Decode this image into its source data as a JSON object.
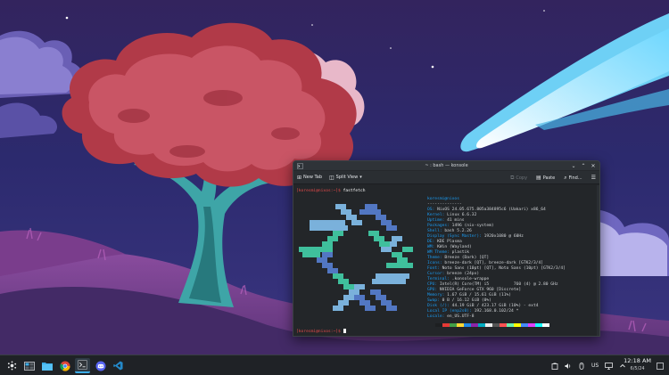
{
  "window": {
    "title": "~ : bash — konsole",
    "minimize_glyph": "⌄",
    "maximize_glyph": "⌃",
    "close_glyph": "✕"
  },
  "toolbar": {
    "new_tab": "New Tab",
    "split_view": "Split View",
    "split_chevron": "▾",
    "copy": "Copy",
    "paste": "Paste",
    "find": "Find...",
    "new_tab_icon": "⊞",
    "split_icon": "◫",
    "copy_icon": "⧉",
    "paste_icon": "▤",
    "find_icon": "⌕",
    "menu_icon": "☰"
  },
  "terminal": {
    "prompt1_user": "[koresmi@nixos:~]$",
    "command1": " fastfetch",
    "header": "koresmi@nixos",
    "separator": "--------------",
    "info": [
      {
        "key": "OS:",
        "value": " NixOS 24.05.675.805a384895c6 (Uakari) x86_64"
      },
      {
        "key": "Kernel:",
        "value": " Linux 6.6.32"
      },
      {
        "key": "Uptime:",
        "value": " 41 mins"
      },
      {
        "key": "Packages:",
        "value": " 1496 (nix-system)"
      },
      {
        "key": "Shell:",
        "value": " bash 5.2.26"
      },
      {
        "key": "Display (Sync Master):",
        "value": " 1920x1080 @ 60Hz"
      },
      {
        "key": "DE:",
        "value": " KDE Plasma"
      },
      {
        "key": "WM:",
        "value": " KWin (Wayland)"
      },
      {
        "key": "WM Theme:",
        "value": " plastik"
      },
      {
        "key": "Theme:",
        "value": " Breeze (Dark) [QT]"
      },
      {
        "key": "Icons:",
        "value": " breeze-dark [QT], breeze-dark [GTK2/3/4]"
      },
      {
        "key": "Font:",
        "value": " Noto Sans (10pt) [QT], Noto Sans (10pt) [GTK2/3/4]"
      },
      {
        "key": "Cursor:",
        "value": " breeze (24px)"
      },
      {
        "key": "Terminal:",
        "value": " .konsole-wrappe"
      },
      {
        "key": "CPU:",
        "value": " Intel(R) Core(TM) i5          760 (4) @ 2.80 GHz"
      },
      {
        "key": "GPU:",
        "value": " NVIDIA GeForce GTX 960 [Discrete]"
      },
      {
        "key": "Memory:",
        "value": " 1.67 GiB / 15.61 GiB (11%)"
      },
      {
        "key": "Swap:",
        "value": " 0 B / 16.12 GiB (0%)"
      },
      {
        "key": "Disk (/):",
        "value": " 44.19 GiB / 423.17 GiB (10%) - ext4"
      },
      {
        "key": "Local IP (enp2s0):",
        "value": " 192.168.0.102/24 *"
      },
      {
        "key": "Locale:",
        "value": " en_US.UTF-8"
      }
    ],
    "prompt2_user": "[koresmi@nixos:~]$",
    "palette": [
      "#1d1f21",
      "#e53935",
      "#43a047",
      "#fdd835",
      "#1e88e5",
      "#8e24aa",
      "#00acc1",
      "#eeeeee",
      "#555555",
      "#ff5252",
      "#69f0ae",
      "#ffff00",
      "#448aff",
      "#e040fb",
      "#18ffff",
      "#ffffff"
    ]
  },
  "taskbar": {
    "launcher_icon": "kde-launcher-icon",
    "pager_icon": "virtual-desktop-pager-icon",
    "files_icon": "dolphin-folder-icon",
    "chrome_icon": "chrome-icon",
    "konsole_icon": "konsole-icon",
    "discord_icon": "discord-icon",
    "vscode_icon": "vscode-icon",
    "keyboard_layout": "US",
    "time": "12:18 AM",
    "date": "6/5/24"
  },
  "colors": {
    "accent": "#3daee9",
    "nix_light_blue": "#7ab1db",
    "nix_dark_blue": "#5277c3",
    "nix_teal": "#3fbf9c"
  }
}
